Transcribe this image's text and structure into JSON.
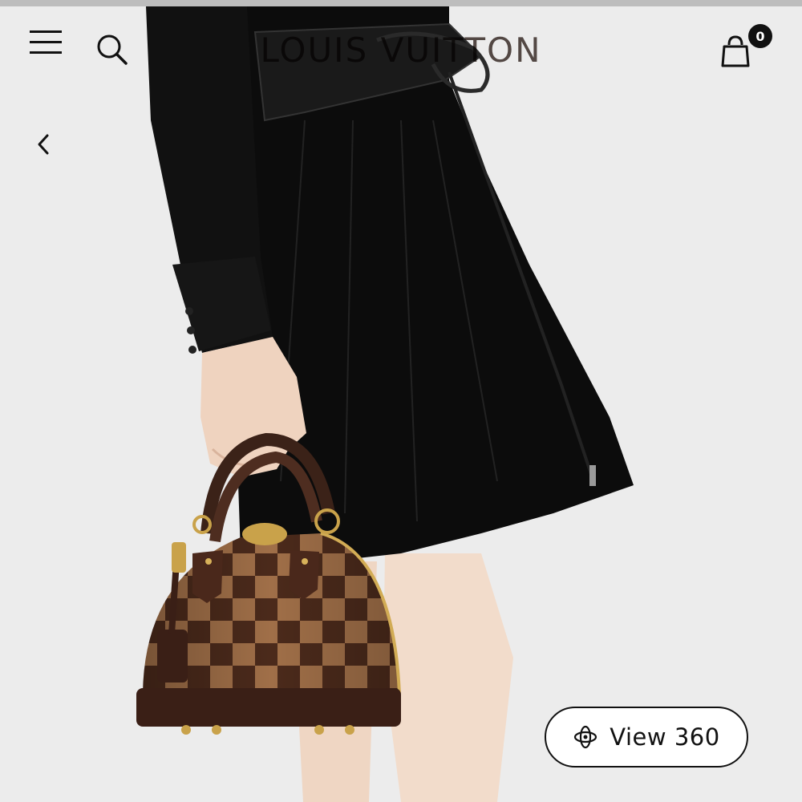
{
  "brand": {
    "logo_text": "LOUIS VUITTON"
  },
  "header": {
    "cart_count": "0"
  },
  "viewer": {
    "view360_label": "View 360"
  },
  "icons": {
    "menu": "hamburger-menu-icon",
    "search": "search-icon",
    "cart": "shopping-bag-icon",
    "back": "chevron-left-icon",
    "view360": "rotate-360-icon"
  },
  "colors": {
    "background": "#ececec",
    "dress": "#0d0d0d",
    "bag_dark": "#4a2a1c",
    "bag_light": "#9a6a45",
    "hardware": "#c9a24a",
    "skin": "#efd9c8"
  }
}
